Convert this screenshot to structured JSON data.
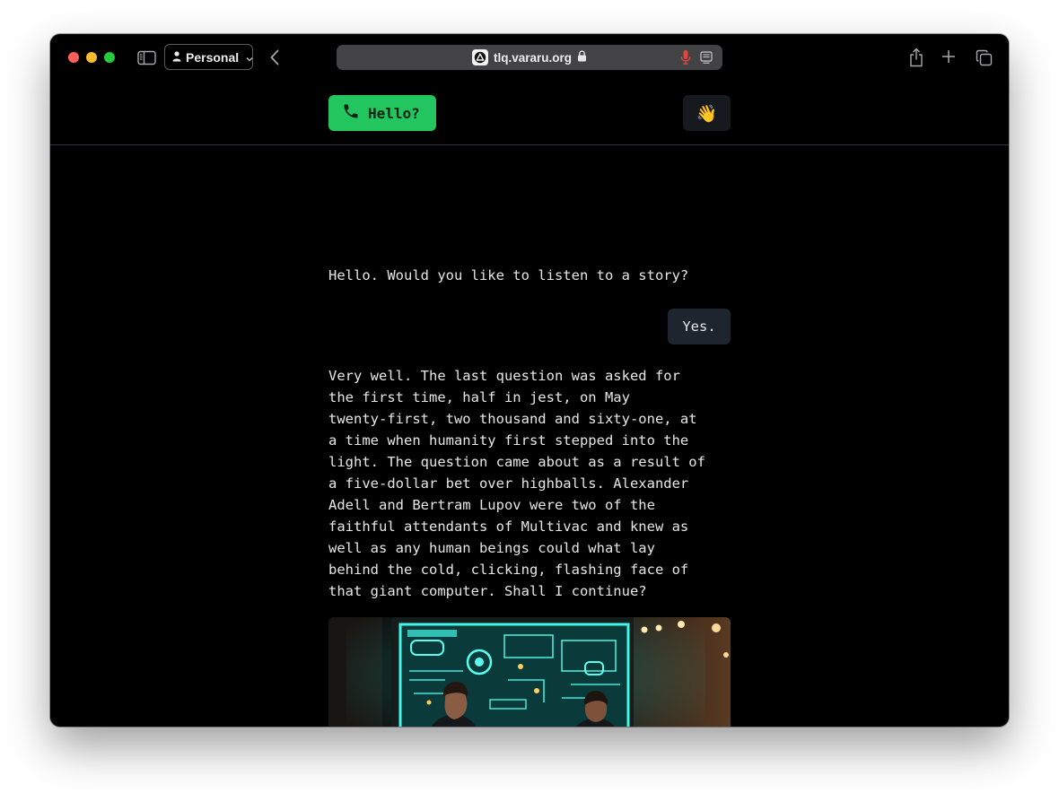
{
  "browser": {
    "profile_label": "Personal",
    "url": "tlq.vararu.org",
    "icons": {
      "sidebar": "sidebar-icon",
      "profile": "person-icon",
      "back": "chevron-left-icon",
      "site": "site-logo-icon",
      "secure": "lock-icon",
      "mic": "microphone-icon",
      "reader": "reader-icon",
      "share": "share-icon",
      "new_tab": "plus-icon",
      "tabs": "tab-overview-icon"
    },
    "colors": {
      "close": "#ff5f57",
      "minimize": "#febc2e",
      "zoom": "#28c840",
      "mic": "#e0463d"
    }
  },
  "app": {
    "call_button_label": "Hello?",
    "call_icon": "📞",
    "wave_icon": "👋",
    "accent": "#22c55e",
    "conversation": {
      "assistant_1": "Hello. Would you like to listen to a story?",
      "user_1": "Yes.",
      "assistant_2": [
        "Very well. The last question was asked for",
        "the first time, half in jest, on May",
        "twenty-first, two thousand and sixty-one, at",
        "a time when humanity first stepped into the",
        "light. The question came about as a result of",
        "a five-dollar bet over highballs. Alexander",
        "Adell and Bertram Lupov were two of the",
        "faithful attendants of Multivac and knew as",
        "well as any human beings could what lay",
        "behind the cold, clicking, flashing face of",
        "that giant computer. Shall I continue?"
      ]
    }
  }
}
